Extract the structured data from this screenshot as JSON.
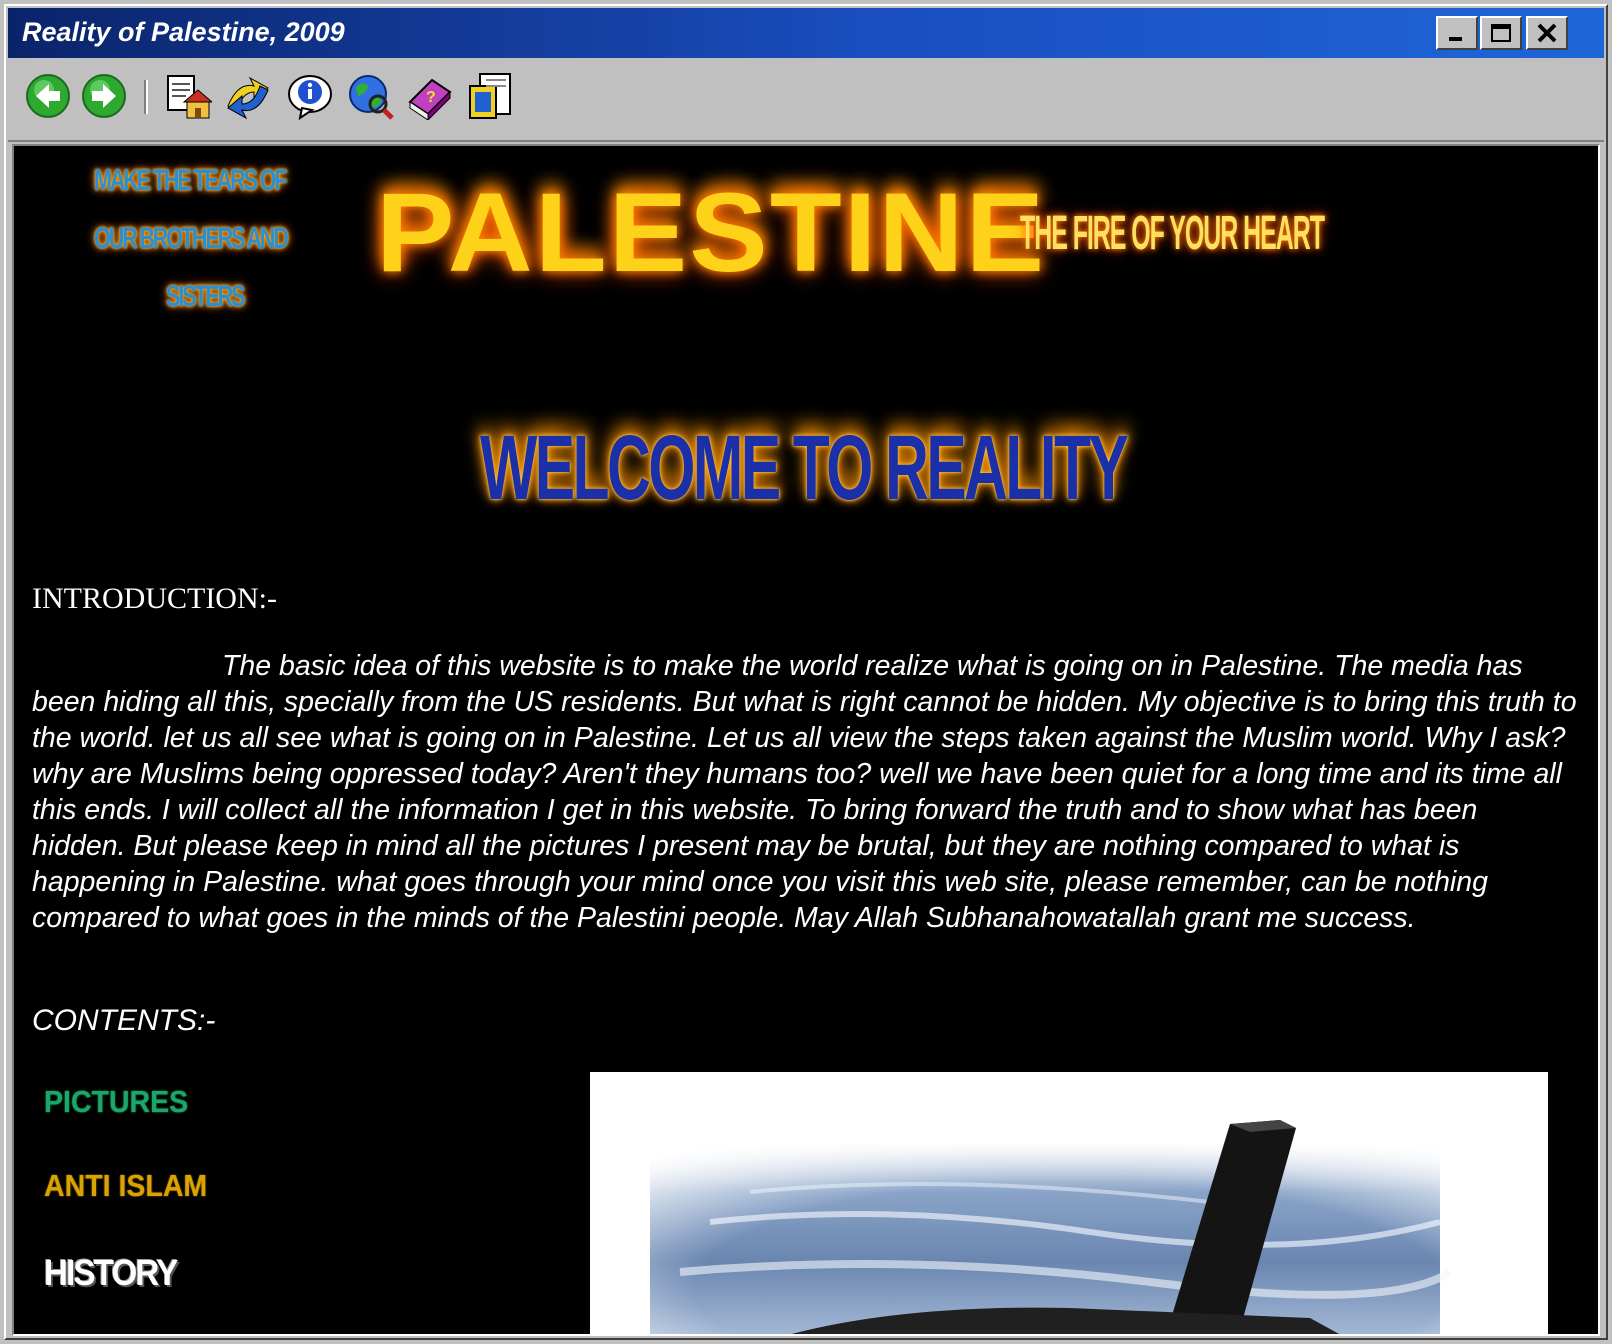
{
  "window": {
    "title": "Reality of Palestine, 2009"
  },
  "toolbar": {
    "buttons": [
      {
        "name": "back",
        "icon": "back-arrow-icon"
      },
      {
        "name": "forward",
        "icon": "forward-arrow-icon"
      },
      {
        "name": "home",
        "icon": "home-page-icon"
      },
      {
        "name": "links",
        "icon": "links-icon"
      },
      {
        "name": "info",
        "icon": "info-icon"
      },
      {
        "name": "web",
        "icon": "globe-icon"
      },
      {
        "name": "help",
        "icon": "help-book-icon"
      },
      {
        "name": "credits",
        "icon": "credits-icon"
      }
    ]
  },
  "banner": {
    "tagline_lines": [
      "MAKE THE TEARS OF",
      "OUR BROTHERS AND",
      "SISTERS"
    ],
    "title": "PALESTINE",
    "subtitle": "THE FIRE OF YOUR HEART",
    "welcome": "WELCOME TO REALITY"
  },
  "intro": {
    "heading": "INTRODUCTION:-",
    "body": "The basic idea of this website is to make the world realize what is going on in Palestine. The media has been hiding all this, specially from the US residents. But what is right cannot be hidden. My objective is to bring this truth to the world. let us all see what is going on in Palestine. Let us all view the  steps taken against the Muslim world. Why I ask? why are Muslims being oppressed today? Aren't they humans too? well we have been quiet for a long time and its time all this ends. I will collect all the information I get in this website. To bring forward the truth and to show what has been hidden. But please keep in mind all the pictures I present may be brutal, but they are nothing compared to what is happening in Palestine. what goes through your mind once you visit this web site, please remember, can be nothing compared to what goes in the minds of the Palestini people. May Allah Subhanahowatallah grant me success."
  },
  "contents": {
    "heading": "CONTENTS:-",
    "links": [
      "PICTURES",
      "ANTI ISLAM",
      "HISTORY"
    ]
  },
  "colors": {
    "titlebar_start": "#0a246a",
    "titlebar_end": "#1e66d8",
    "page_background": "#000000",
    "fire": "#ffd21a",
    "pictures_link": "#1ea56b",
    "anti_islam_link": "#d9a300",
    "history_link": "#ffffff"
  }
}
